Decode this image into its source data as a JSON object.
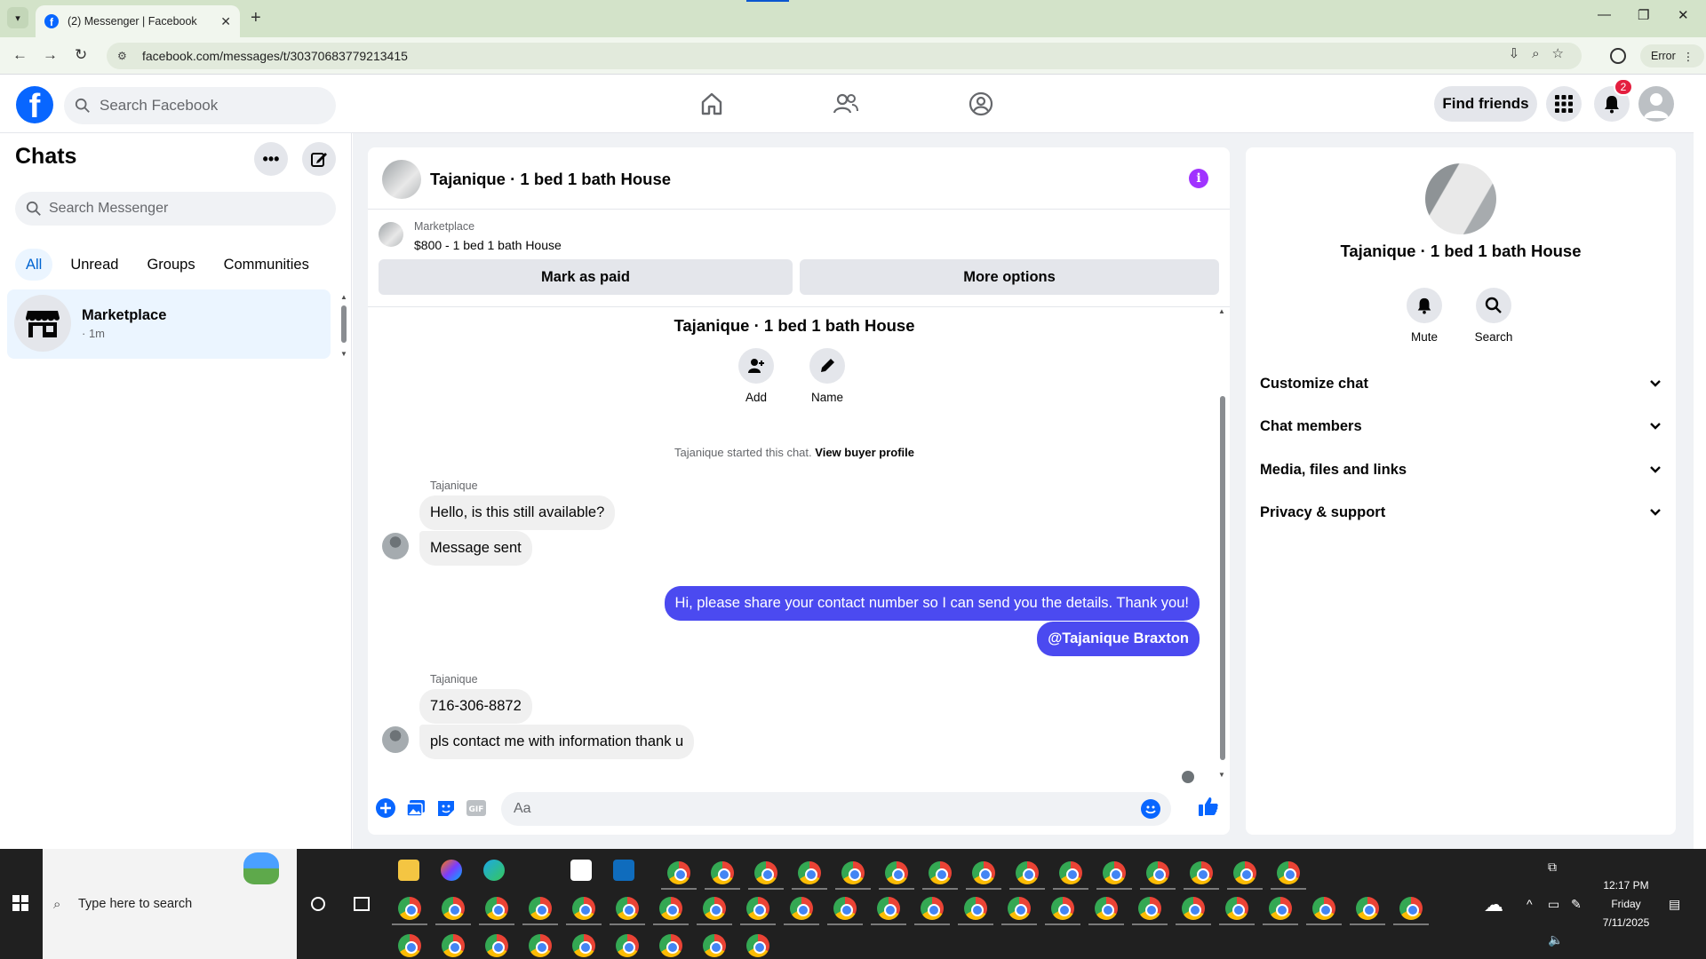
{
  "browser": {
    "tab_title": "(2) Messenger | Facebook",
    "url": "facebook.com/messages/t/30370683779213415",
    "error_label": "Error"
  },
  "fb": {
    "search_placeholder": "Search Facebook",
    "find_friends": "Find friends",
    "notification_count": "2"
  },
  "chats": {
    "title": "Chats",
    "search_placeholder": "Search Messenger",
    "filters": [
      "All",
      "Unread",
      "Groups",
      "Communities"
    ],
    "items": [
      {
        "name": "Marketplace",
        "time": "· 1m"
      }
    ]
  },
  "conversation": {
    "header_name": "Tajanique · 1 bed 1 bath House",
    "marketplace_label": "Marketplace",
    "listing": "$800 - 1 bed 1 bath House",
    "mark_paid": "Mark as paid",
    "more_options": "More options",
    "thread_title": "Tajanique · 1 bed 1 bath House",
    "actions": [
      "Add",
      "Name"
    ],
    "started_text": "Tajanique started this chat.",
    "view_profile": "View buyer profile",
    "messages": [
      {
        "sender": "Tajanique",
        "text": "Hello, is this still available?"
      },
      {
        "text": "Message sent"
      },
      {
        "text": "Hi, please share your contact number so I can send you the details. Thank you!"
      },
      {
        "text": "@Tajanique Braxton"
      },
      {
        "sender": "Tajanique",
        "text": "716-306-8872"
      },
      {
        "text": "pls contact me with information thank u"
      }
    ],
    "composer_placeholder": "Aa"
  },
  "info_panel": {
    "name": "Tajanique · 1 bed 1 bath House",
    "actions": [
      "Mute",
      "Search"
    ],
    "sections": [
      "Customize chat",
      "Chat members",
      "Media, files and links",
      "Privacy & support"
    ]
  },
  "taskbar": {
    "search_placeholder": "Type here to search",
    "time": "12:17 PM",
    "day": "Friday",
    "date": "7/11/2025"
  },
  "colors": {
    "brand": "#0866ff",
    "outgoing_bubble": "#4b4af0",
    "active_chat": "#ebf5ff",
    "info_icon": "#a033ff"
  }
}
